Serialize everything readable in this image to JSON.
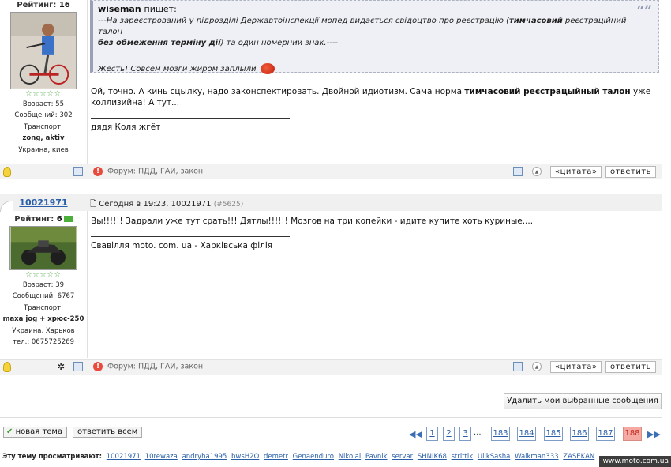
{
  "post1": {
    "rating_label": "Рейтинг:",
    "rating_value": "16",
    "stars": "☆☆☆☆☆",
    "age": "Возраст: 55",
    "messages": "Сообщений: 302",
    "transport_label": "Транспорт:",
    "transport": "zong, aktiv",
    "location": "Украина, киев",
    "quote_author": "wiseman",
    "quote_says": "пишет:",
    "quote_line1_a": "---На зареєстрований у підрозділі Державтоінспекції мопед видається свідоцтво про реєстрацію (",
    "quote_line1_b": "тимчасовий",
    "quote_line1_c": " реєстраційний талон",
    "quote_line2_a": "без обмеження терміну дії",
    "quote_line2_b": ") та один номерний знак.----",
    "quote_reply": "Жесть! Совсем мозги жиром заплыли",
    "body_a": "Ой, точно. А кинь сцылку, надо законспектировать. Двойной идиотизм. Сама норма ",
    "body_b": "тимчасовий реєстрацыйный талон",
    "body_c": " уже коллизийна! А тут...",
    "signature": "дядя Коля жгёт",
    "forum_text": "Форум: ПДД, ГАИ, закон",
    "quote_button": "«цитата»",
    "reply_button": "ответить"
  },
  "post2": {
    "username": "10021971",
    "date": "Сегодня в 19:23, 10021971",
    "post_number": "(#5625)",
    "rating_label": "Рейтинг:",
    "rating_value": "6",
    "stars": "☆☆☆☆☆",
    "age": "Возраст: 39",
    "messages": "Сообщений: 6767",
    "transport_label": "Транспорт:",
    "transport": "maxa jog + хрюс-250",
    "location": "Украина, Харьков",
    "phone": "тел.: 0675725269",
    "body": "Вы!!!!!! Задрали уже тут срать!!! Дятлы!!!!!! Мозгов на три копейки - идите купите хоть куриные....",
    "signature": "Свавілля moto. com. ua - Харківська філія",
    "forum_text": "Форум: ПДД, ГАИ, закон",
    "quote_button": "«цитата»",
    "reply_button": "ответить"
  },
  "delete_selected": "Удалить мои выбранные сообщения",
  "new_topic": "новая тема",
  "reply_all": "ответить всем",
  "pagination": {
    "pages": [
      "1",
      "2",
      "3",
      "183",
      "184",
      "185",
      "186",
      "187",
      "188"
    ],
    "ellipsis": "...",
    "current": "188"
  },
  "viewers": {
    "label": "Эту тему просматривают:",
    "users": [
      "10021971",
      "10rewaza",
      "andryha1995",
      "bwsH2O",
      "demetr",
      "Genaenduro",
      "Nikolai",
      "Pavnik",
      "servar",
      "SHNIK68",
      "strittik",
      "UlikSasha",
      "Walkman333",
      "ZASEKAN"
    ]
  },
  "watermark": "www.moto.com.ua",
  "colors": {
    "link": "#2a5fa8",
    "current_page": "#f4a9a3",
    "star": "#48a33b"
  }
}
